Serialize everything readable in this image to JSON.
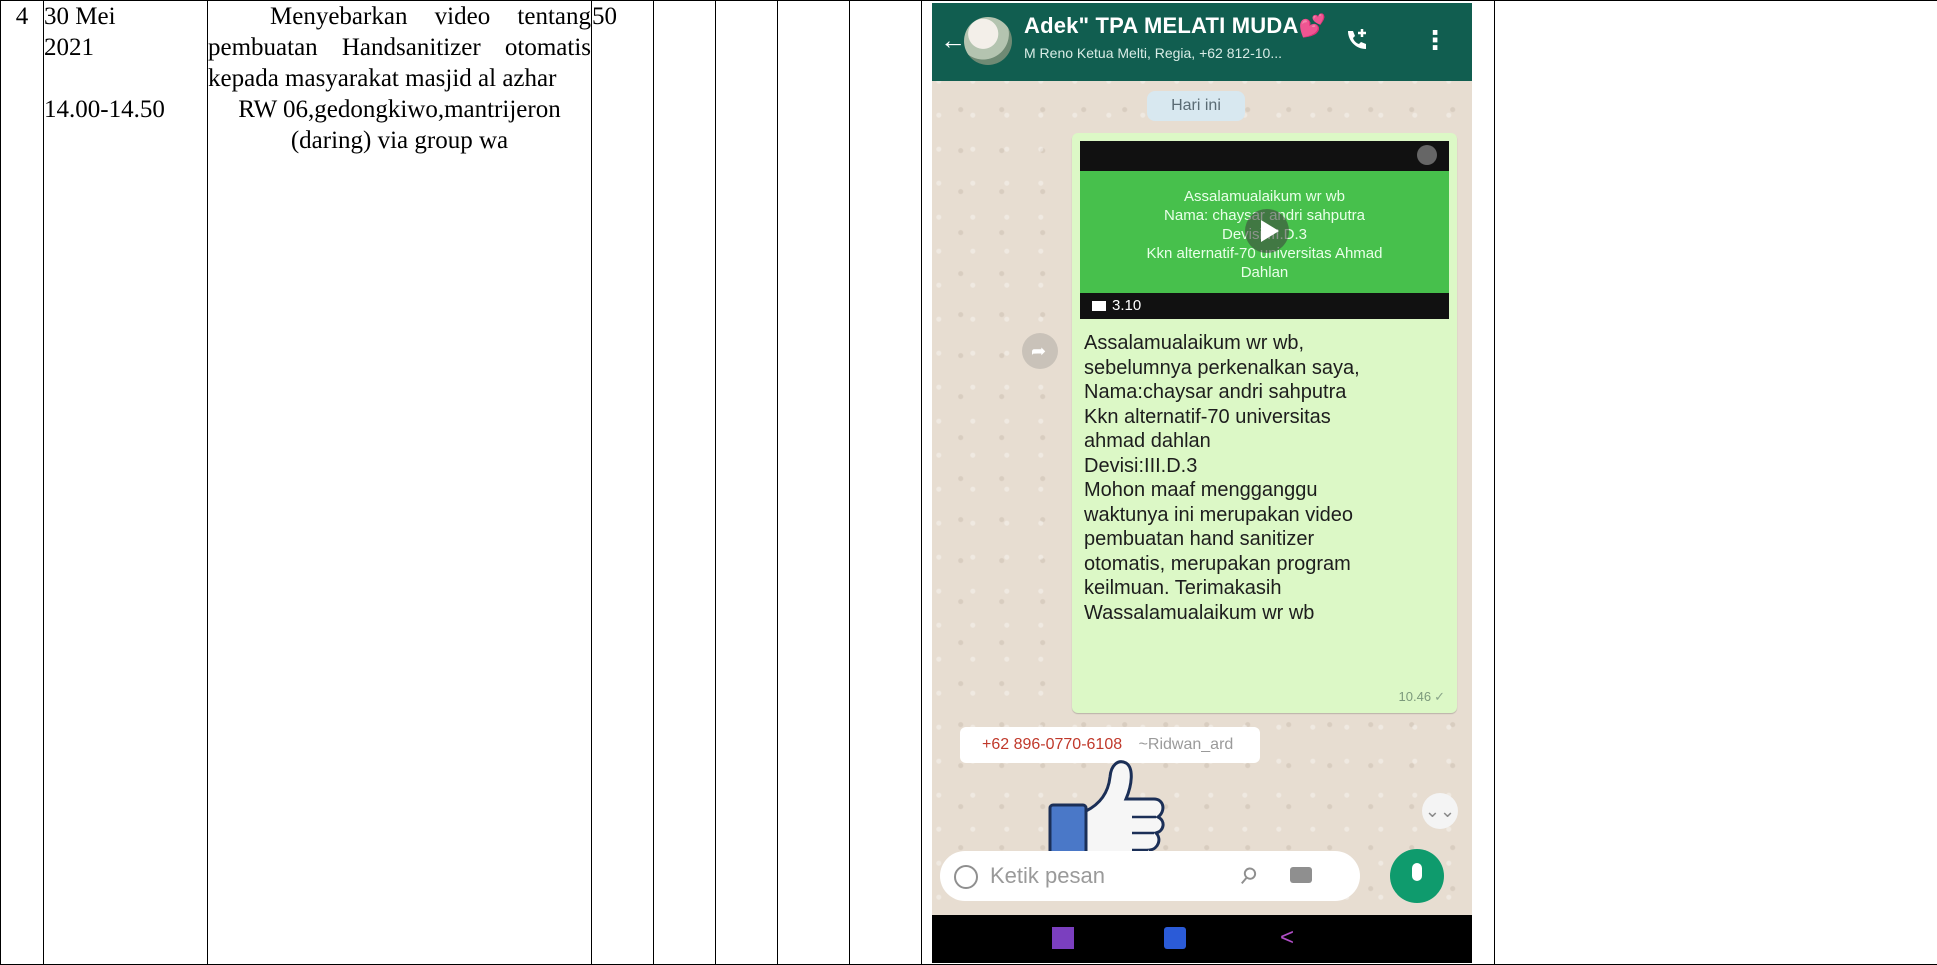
{
  "row": {
    "number": "4",
    "date_line1": "30 Mei",
    "date_line2": "2021",
    "time": "14.00-14.50",
    "activity_line1": "Menyebarkan video tentang pembuatan Handsanitizer otomatis kepada masyarakat masjid al azhar",
    "activity_line2": "RW 06,gedongkiwo,mantrijeron (daring) via group wa",
    "value": "50"
  },
  "chat": {
    "title": "Adek\" TPA MELATI MUDA",
    "heart": "💕",
    "subtitle": "M Reno Ketua Melti, Regia, +62 812-10...",
    "day_label": "Hari ini",
    "video": {
      "line1": "Assalamualaikum wr wb",
      "line2": "Nama: chaysar andri sahputra",
      "line3": "Devisi III.D.3",
      "line4": "Kkn alternatif-70 universitas Ahmad",
      "line5": "Dahlan",
      "duration": "3.10"
    },
    "message_lines": [
      "Assalamualaikum wr wb,",
      "sebelumnya perkenalkan saya,",
      "Nama:chaysar andri sahputra",
      "Kkn alternatif-70 universitas",
      "ahmad dahlan",
      "Devisi:III.D.3",
      "Mohon maaf mengganggu",
      "waktunya ini merupakan video",
      "pembuatan hand sanitizer",
      "otomatis, merupakan program",
      "keilmuan. Terimakasih",
      "Wassalamualaikum wr wb"
    ],
    "message_time": "10.46",
    "sender_number": "+62 896-0770-6108",
    "sender_name": "~Ridwan_ard",
    "input_placeholder": "Ketik pesan"
  },
  "colors": {
    "header": "#115e50",
    "bubble": "#dcf8c6",
    "video_green": "#47c04c",
    "mic": "#0f9b6d"
  },
  "icons": [
    "back-arrow-icon",
    "add-call-icon",
    "more-menu-icon",
    "play-icon",
    "video-camera-icon",
    "forward-icon",
    "thumbs-up-sticker",
    "scroll-down-icon",
    "emoji-icon",
    "attach-icon",
    "camera-icon",
    "mic-icon",
    "recent-apps-icon",
    "home-icon",
    "nav-back-icon"
  ]
}
